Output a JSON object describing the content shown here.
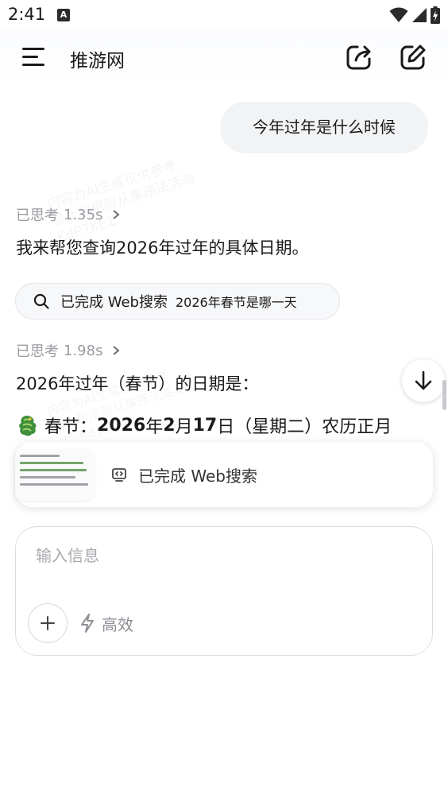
{
  "status_bar": {
    "time": "2:41",
    "notification_badge": "A",
    "icons": [
      "wifi-icon",
      "signal-icon",
      "battery-charging-icon"
    ]
  },
  "header": {
    "title": "推游网",
    "actions": [
      "share-icon",
      "new-chat-icon"
    ]
  },
  "conversation": {
    "user_message": "今年过年是什么时候",
    "thinking_1": {
      "label": "已思考",
      "duration": "1.35s"
    },
    "ai_text_1": "我来帮您查询2026年过年的具体日期。",
    "web_search": {
      "label": "已完成 Web搜索",
      "query": "2026年春节是哪一天"
    },
    "thinking_2": {
      "label": "已思考",
      "duration": "1.98s"
    },
    "ai_text_2": "2026年过年（春节）的日期是：",
    "festival": {
      "label": "春节：",
      "year": "2026",
      "year_unit": "年",
      "month": "2",
      "month_unit": "月",
      "day": "17",
      "day_unit": "日",
      "weekday": "（星期二）农历正月"
    }
  },
  "result_card": {
    "label": "已完成 Web搜索"
  },
  "watermark": {
    "line1": "内容为AI生成仅供参考",
    "line2": "禁止利用服从事违法活动",
    "line3": "KdP7KEZ",
    "line4": "内容为AI生成仅供参考",
    "line5": "禁止利用服从事违法活动",
    "line6": "7J9Wd1E"
  },
  "composer": {
    "placeholder": "输入信息",
    "mode_label": "高效"
  },
  "colors": {
    "accent_text": "#1a1a1a",
    "muted": "#9a9ca1",
    "bubble": "#f2f3f5"
  }
}
